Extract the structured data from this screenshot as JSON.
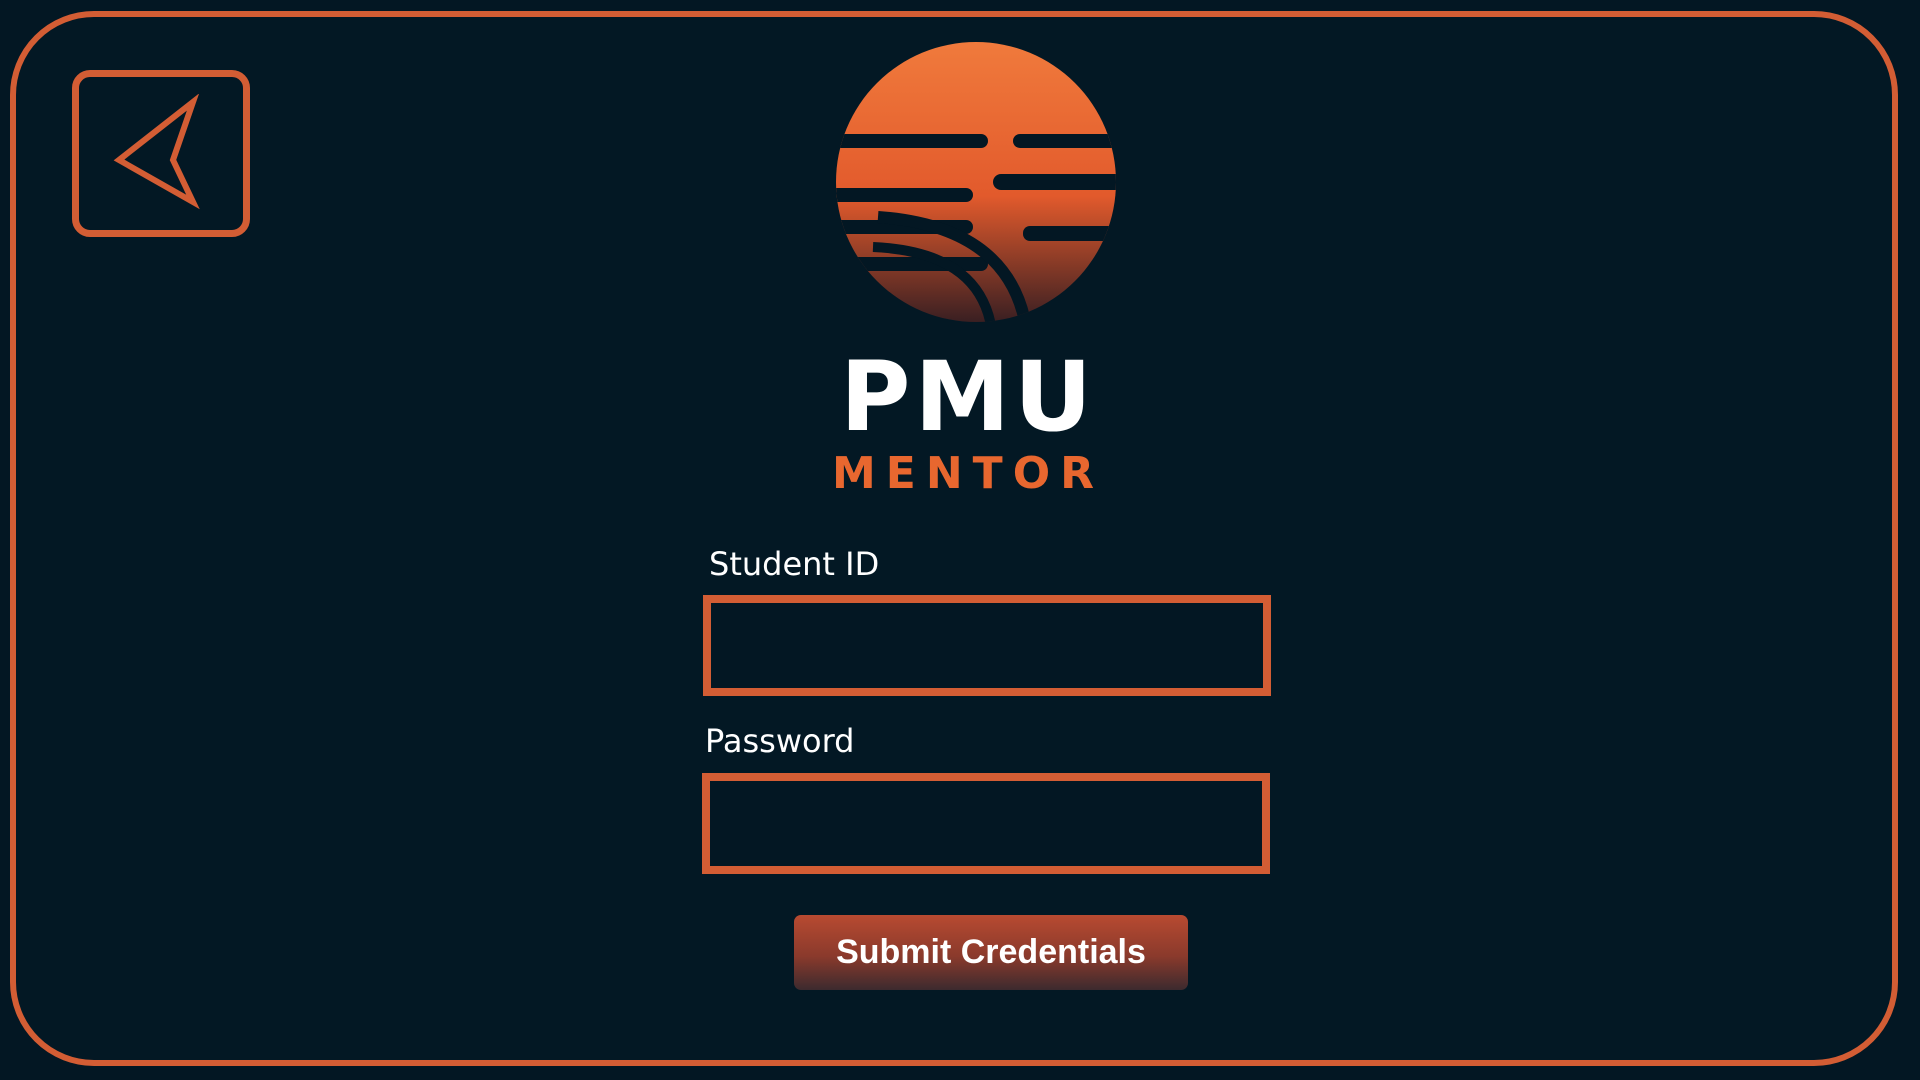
{
  "back": {
    "icon": "back-arrow-icon"
  },
  "logo": {
    "icon": "sun-logo-icon",
    "title": "PMU",
    "subtitle": "MENTOR"
  },
  "form": {
    "student_id_label": "Student ID",
    "student_id_value": "",
    "password_label": "Password",
    "password_value": "",
    "submit_label": "Submit Credentials"
  },
  "colors": {
    "background": "#031723",
    "accent": "#d35d34",
    "logo_orange": "#e8672f",
    "text": "#ffffff"
  }
}
